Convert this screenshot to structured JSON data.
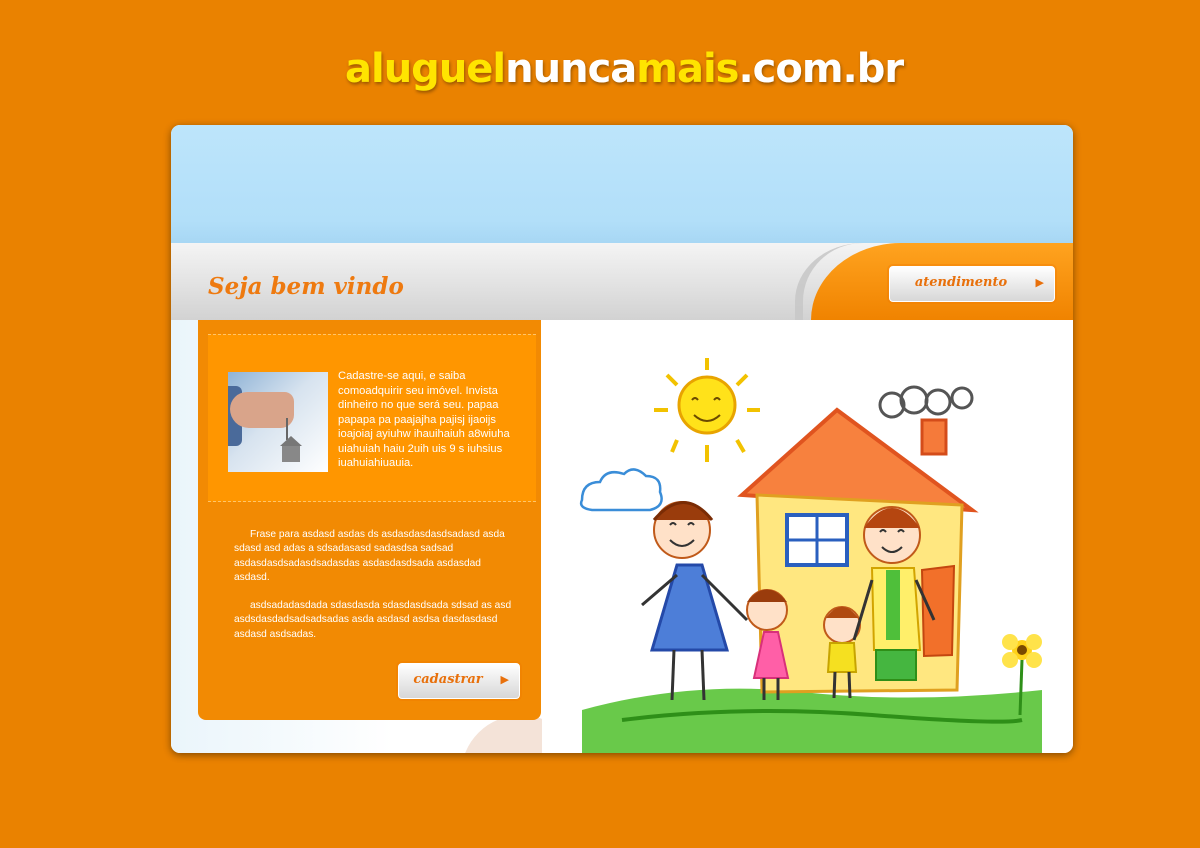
{
  "site": {
    "logo_parts": [
      "aluguel",
      "nunca",
      "mais",
      ".com.br"
    ]
  },
  "header": {
    "welcome": "Seja bem vindo",
    "atendimento_label": "atendimento"
  },
  "feature": {
    "text": "Cadastre-se aqui, e saiba comoadquirir seu imóvel. Invista dinheiro no que será seu. papaa papapa pa paajajha pajisj ijaoijs ioajoiaj ayiuhw  ihauihaiuh a8wiuha uiahuiah haiu  2uih uis 9 s iuhsius iuahuiahiuauia."
  },
  "description": {
    "paragraph1": "Frase para asdasd asdas ds asdasdasdasdsadasd asda sdasd asd adas a sdsadasasd sadasdsa sadsad asdasdasdsadasdsadasdas asdasdasdsada asdasdad asdasd.",
    "paragraph2": "asdsadadasdada sdasdasda sdasdasdsada sdsad as asd asdsdasdadsadsadsadas  asda asdasd asdsa dasdasdasd asdasd asdsadas."
  },
  "buttons": {
    "cadastrar_label": "cadastrar",
    "arrow_icon": "triangle-right-icon"
  },
  "colors": {
    "background": "#ea8200",
    "accent": "#ee7a10",
    "logo_yellow": "#ffe400",
    "sky": "#b4e0fa"
  }
}
